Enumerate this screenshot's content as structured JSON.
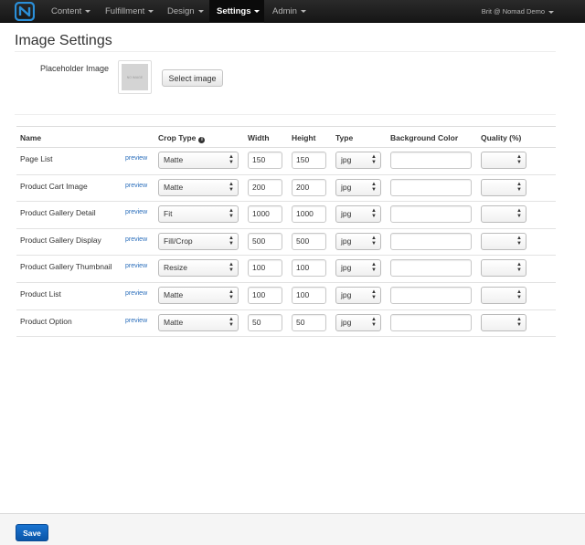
{
  "nav": {
    "items": [
      {
        "label": "Content"
      },
      {
        "label": "Fulfillment"
      },
      {
        "label": "Design"
      },
      {
        "label": "Settings"
      },
      {
        "label": "Admin"
      }
    ],
    "active": "Settings",
    "user": "Brit @ Nomad Demo"
  },
  "page": {
    "title": "Image Settings",
    "placeholder_label": "Placeholder Image",
    "placeholder_thumb_text": "NO IMAGE",
    "select_image_label": "Select image"
  },
  "table": {
    "headers": {
      "name": "Name",
      "crop_type": "Crop Type",
      "width": "Width",
      "height": "Height",
      "type": "Type",
      "background": "Background Color",
      "quality": "Quality (%)"
    },
    "preview_label": "preview",
    "rows": [
      {
        "name": "Page List",
        "crop": "Matte",
        "width": "150",
        "height": "150",
        "type": "jpg",
        "background": "",
        "quality": ""
      },
      {
        "name": "Product Cart Image",
        "crop": "Matte",
        "width": "200",
        "height": "200",
        "type": "jpg",
        "background": "",
        "quality": ""
      },
      {
        "name": "Product Gallery Detail",
        "crop": "Fit",
        "width": "1000",
        "height": "1000",
        "type": "jpg",
        "background": "",
        "quality": ""
      },
      {
        "name": "Product Gallery Display",
        "crop": "Fill/Crop",
        "width": "500",
        "height": "500",
        "type": "jpg",
        "background": "",
        "quality": ""
      },
      {
        "name": "Product Gallery Thumbnail",
        "crop": "Resize",
        "width": "100",
        "height": "100",
        "type": "jpg",
        "background": "",
        "quality": ""
      },
      {
        "name": "Product List",
        "crop": "Matte",
        "width": "100",
        "height": "100",
        "type": "jpg",
        "background": "",
        "quality": ""
      },
      {
        "name": "Product Option",
        "crop": "Matte",
        "width": "50",
        "height": "50",
        "type": "jpg",
        "background": "",
        "quality": ""
      }
    ]
  },
  "footer": {
    "save_label": "Save"
  },
  "colors": {
    "navbar": "#1f1f1f",
    "link": "#2a6ebb",
    "primary": "#0a62c1",
    "logo": "#2b8fd8"
  }
}
